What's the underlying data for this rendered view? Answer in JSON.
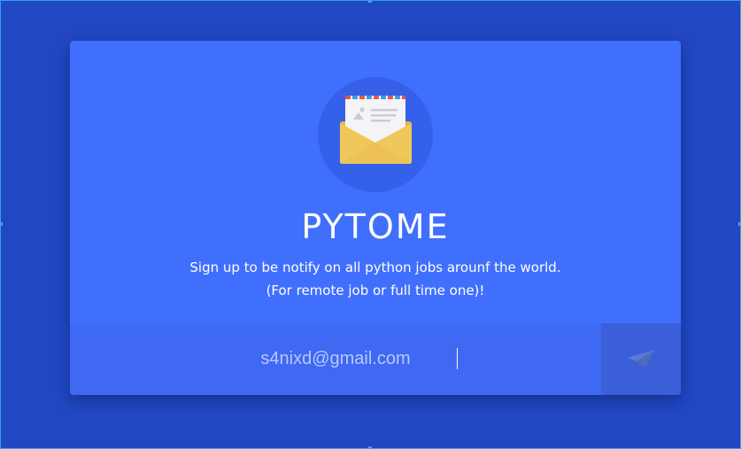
{
  "app": {
    "title": "PYTOME",
    "subtitle_line1": "Sign up to be notify on all python jobs arounf the world.",
    "subtitle_line2": "(For remote job or full time one)!"
  },
  "form": {
    "email_value": "s4nixd@gmail.com",
    "send_icon": "paper-plane-icon"
  },
  "icons": {
    "hero": "envelope-letter-icon"
  },
  "colors": {
    "background": "#2147c2",
    "card": "#416ffd",
    "input_bar": "#3f69f3",
    "send_button": "#3b5fd8",
    "icon_circle": "#3561ea",
    "envelope": "#f0c75a"
  }
}
